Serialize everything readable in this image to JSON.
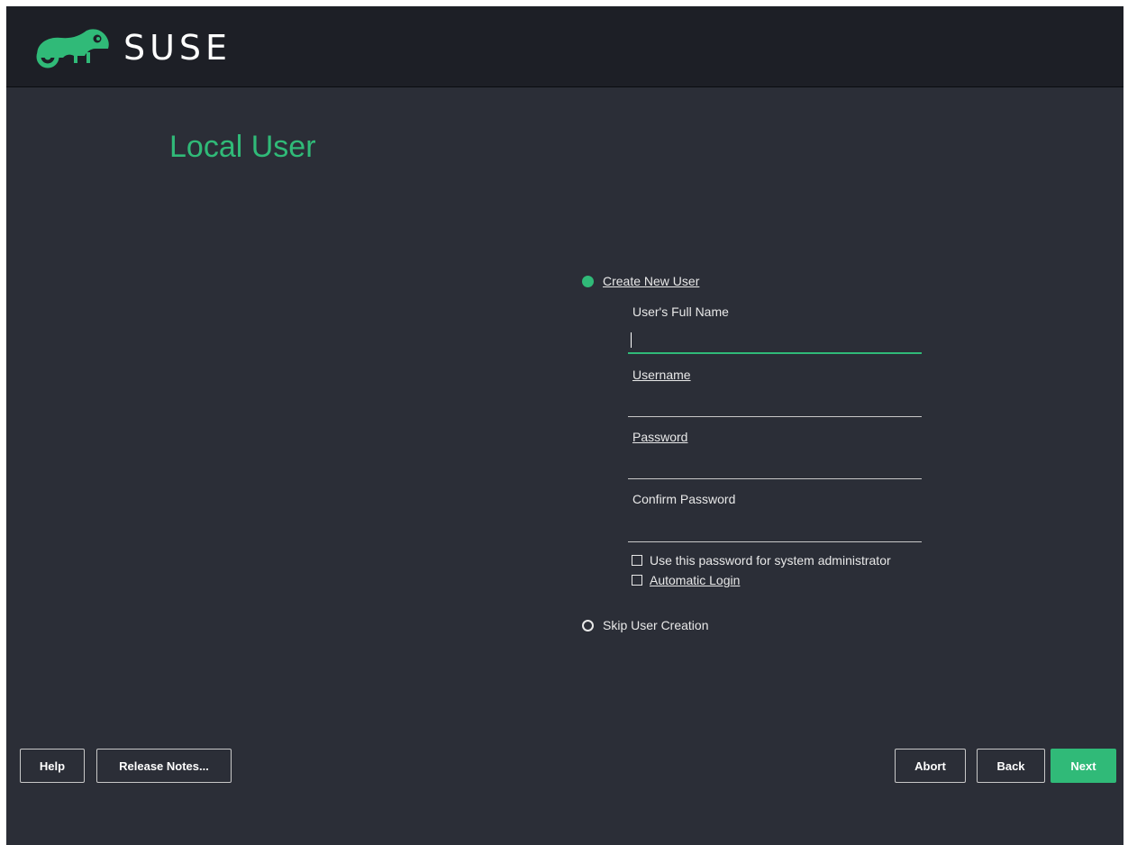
{
  "brand": {
    "name": "SUSE",
    "accent": "#30ba78",
    "background": "#2b2e37",
    "header_bg": "#1d1f26"
  },
  "page": {
    "title": "Local User"
  },
  "options": {
    "create": {
      "label": "Create New User",
      "selected": true
    },
    "skip": {
      "label": "Skip User Creation",
      "selected": false
    }
  },
  "fields": {
    "full_name": {
      "label": "User's Full Name",
      "value": ""
    },
    "username": {
      "label": "Username",
      "value": ""
    },
    "password": {
      "label": "Password",
      "value": ""
    },
    "confirm_password": {
      "label": "Confirm Password",
      "value": ""
    }
  },
  "checkboxes": {
    "use_for_admin": {
      "label": "Use this password for system administrator",
      "checked": false
    },
    "auto_login": {
      "label": "Automatic Login",
      "checked": false
    }
  },
  "buttons": {
    "help": "Help",
    "release_notes": "Release Notes...",
    "abort": "Abort",
    "back": "Back",
    "next": "Next"
  },
  "icons": [
    "chameleon-logo-icon",
    "radio-selected-icon",
    "radio-unselected-icon",
    "checkbox-icon"
  ]
}
